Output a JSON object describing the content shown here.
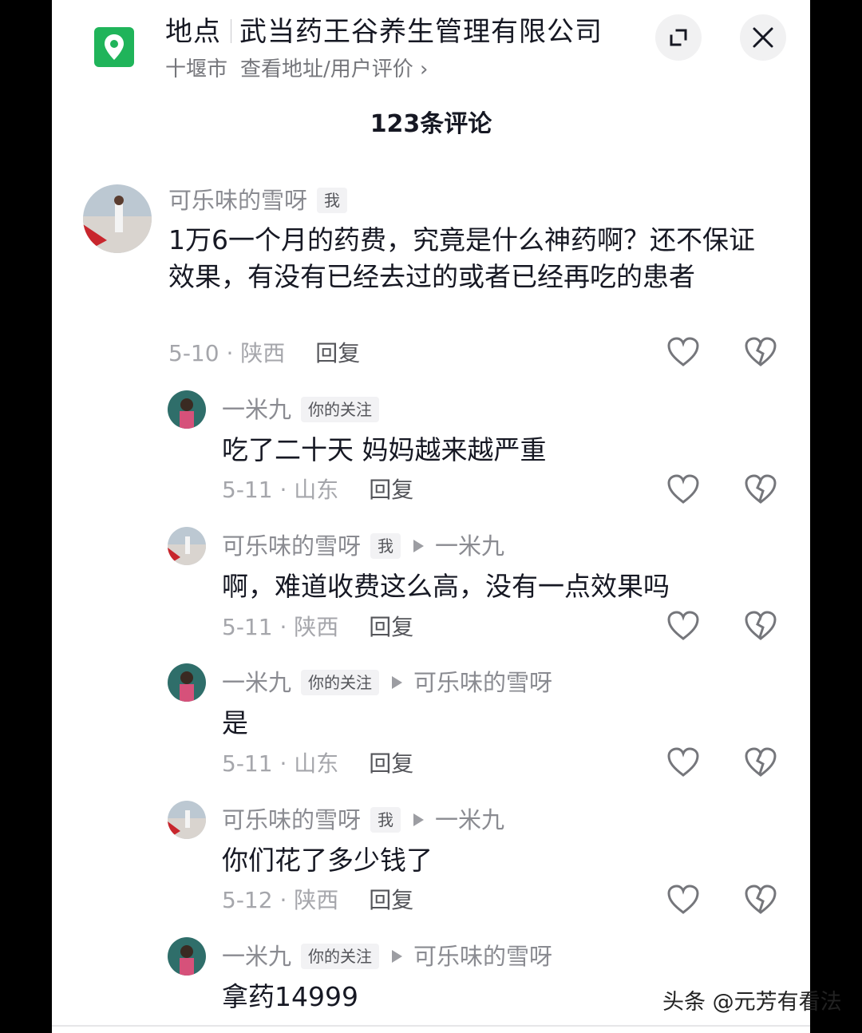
{
  "header": {
    "location_label": "地点",
    "business_name": "武当药王谷养生管理有限公司",
    "city": "十堰市",
    "details_link": "查看地址/用户评价 ›",
    "icons": [
      "location-pin-icon",
      "expand-icon",
      "close-icon"
    ]
  },
  "comments_title": "123条评论",
  "comments": [
    {
      "username": "可乐味的雪呀",
      "tag": "我",
      "text": "1万6一个月的药费，究竟是什么神药啊？还不保证效果，有没有已经去过的或者已经再吃的患者",
      "date_region": "5-10 · 陕西",
      "reply": "回复"
    },
    {
      "username": "一米九",
      "tag": "你的关注",
      "text": "吃了二十天 妈妈越来越严重",
      "date_region": "5-11 · 山东",
      "reply": "回复"
    },
    {
      "username": "可乐味的雪呀",
      "tag": "我",
      "reply_to": "一米九",
      "text": "啊，难道收费这么高，没有一点效果吗",
      "date_region": "5-11 · 陕西",
      "reply": "回复"
    },
    {
      "username": "一米九",
      "tag": "你的关注",
      "reply_to": "可乐味的雪呀",
      "text": "是",
      "date_region": "5-11 · 山东",
      "reply": "回复"
    },
    {
      "username": "可乐味的雪呀",
      "tag": "我",
      "reply_to": "一米九",
      "text": "你们花了多少钱了",
      "date_region": "5-12 · 陕西",
      "reply": "回复"
    },
    {
      "username": "一米九",
      "tag": "你的关注",
      "reply_to": "可乐味的雪呀",
      "text": "拿药14999"
    }
  ],
  "watermark": "头条 @元芳有看法",
  "colors": {
    "pin_green": "#20b45a",
    "username_gray": "#8a8b91",
    "text_dark": "#161823"
  }
}
